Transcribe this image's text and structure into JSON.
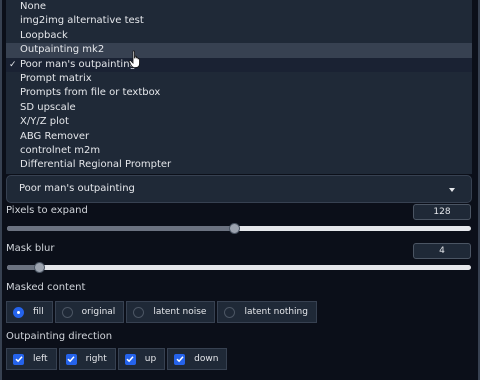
{
  "dropdown": {
    "items": [
      {
        "label": "None"
      },
      {
        "label": "img2img alternative test"
      },
      {
        "label": "Loopback"
      },
      {
        "label": "Outpainting mk2"
      },
      {
        "label": "Poor man's outpainting",
        "checkmark": "✓"
      },
      {
        "label": "Prompt matrix"
      },
      {
        "label": "Prompts from file or textbox"
      },
      {
        "label": "SD upscale"
      },
      {
        "label": "X/Y/Z plot"
      },
      {
        "label": "ABG Remover"
      },
      {
        "label": "controlnet m2m"
      },
      {
        "label": "Differential Regional Prompter"
      }
    ],
    "hovered_index": 3,
    "selected_index": 4
  },
  "script_select": {
    "value": "Poor man's outpainting",
    "icon": "chevron-down-icon"
  },
  "pixels_to_expand": {
    "label": "Pixels to expand",
    "value": "128",
    "fraction": 0.49
  },
  "mask_blur": {
    "label": "Mask blur",
    "value": "4",
    "fraction": 0.07
  },
  "masked_content": {
    "label": "Masked content",
    "options": [
      "fill",
      "original",
      "latent noise",
      "latent nothing"
    ],
    "selected": "fill"
  },
  "outpainting_direction": {
    "label": "Outpainting direction",
    "options": [
      "left",
      "right",
      "up",
      "down"
    ],
    "checked": [
      "left",
      "right",
      "up",
      "down"
    ]
  },
  "colors": {
    "accent": "#2563eb",
    "panel": "#1f2937",
    "background": "#0b0f19"
  }
}
